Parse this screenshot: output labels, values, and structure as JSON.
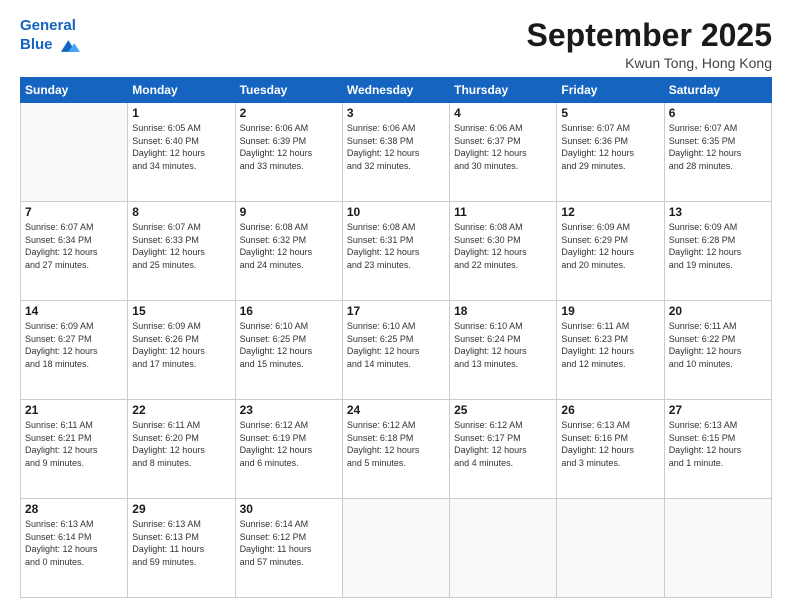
{
  "header": {
    "logo_line1": "General",
    "logo_line2": "Blue",
    "title": "September 2025",
    "subtitle": "Kwun Tong, Hong Kong"
  },
  "days_of_week": [
    "Sunday",
    "Monday",
    "Tuesday",
    "Wednesday",
    "Thursday",
    "Friday",
    "Saturday"
  ],
  "weeks": [
    [
      {
        "day": "",
        "info": ""
      },
      {
        "day": "1",
        "info": "Sunrise: 6:05 AM\nSunset: 6:40 PM\nDaylight: 12 hours\nand 34 minutes."
      },
      {
        "day": "2",
        "info": "Sunrise: 6:06 AM\nSunset: 6:39 PM\nDaylight: 12 hours\nand 33 minutes."
      },
      {
        "day": "3",
        "info": "Sunrise: 6:06 AM\nSunset: 6:38 PM\nDaylight: 12 hours\nand 32 minutes."
      },
      {
        "day": "4",
        "info": "Sunrise: 6:06 AM\nSunset: 6:37 PM\nDaylight: 12 hours\nand 30 minutes."
      },
      {
        "day": "5",
        "info": "Sunrise: 6:07 AM\nSunset: 6:36 PM\nDaylight: 12 hours\nand 29 minutes."
      },
      {
        "day": "6",
        "info": "Sunrise: 6:07 AM\nSunset: 6:35 PM\nDaylight: 12 hours\nand 28 minutes."
      }
    ],
    [
      {
        "day": "7",
        "info": "Sunrise: 6:07 AM\nSunset: 6:34 PM\nDaylight: 12 hours\nand 27 minutes."
      },
      {
        "day": "8",
        "info": "Sunrise: 6:07 AM\nSunset: 6:33 PM\nDaylight: 12 hours\nand 25 minutes."
      },
      {
        "day": "9",
        "info": "Sunrise: 6:08 AM\nSunset: 6:32 PM\nDaylight: 12 hours\nand 24 minutes."
      },
      {
        "day": "10",
        "info": "Sunrise: 6:08 AM\nSunset: 6:31 PM\nDaylight: 12 hours\nand 23 minutes."
      },
      {
        "day": "11",
        "info": "Sunrise: 6:08 AM\nSunset: 6:30 PM\nDaylight: 12 hours\nand 22 minutes."
      },
      {
        "day": "12",
        "info": "Sunrise: 6:09 AM\nSunset: 6:29 PM\nDaylight: 12 hours\nand 20 minutes."
      },
      {
        "day": "13",
        "info": "Sunrise: 6:09 AM\nSunset: 6:28 PM\nDaylight: 12 hours\nand 19 minutes."
      }
    ],
    [
      {
        "day": "14",
        "info": "Sunrise: 6:09 AM\nSunset: 6:27 PM\nDaylight: 12 hours\nand 18 minutes."
      },
      {
        "day": "15",
        "info": "Sunrise: 6:09 AM\nSunset: 6:26 PM\nDaylight: 12 hours\nand 17 minutes."
      },
      {
        "day": "16",
        "info": "Sunrise: 6:10 AM\nSunset: 6:25 PM\nDaylight: 12 hours\nand 15 minutes."
      },
      {
        "day": "17",
        "info": "Sunrise: 6:10 AM\nSunset: 6:25 PM\nDaylight: 12 hours\nand 14 minutes."
      },
      {
        "day": "18",
        "info": "Sunrise: 6:10 AM\nSunset: 6:24 PM\nDaylight: 12 hours\nand 13 minutes."
      },
      {
        "day": "19",
        "info": "Sunrise: 6:11 AM\nSunset: 6:23 PM\nDaylight: 12 hours\nand 12 minutes."
      },
      {
        "day": "20",
        "info": "Sunrise: 6:11 AM\nSunset: 6:22 PM\nDaylight: 12 hours\nand 10 minutes."
      }
    ],
    [
      {
        "day": "21",
        "info": "Sunrise: 6:11 AM\nSunset: 6:21 PM\nDaylight: 12 hours\nand 9 minutes."
      },
      {
        "day": "22",
        "info": "Sunrise: 6:11 AM\nSunset: 6:20 PM\nDaylight: 12 hours\nand 8 minutes."
      },
      {
        "day": "23",
        "info": "Sunrise: 6:12 AM\nSunset: 6:19 PM\nDaylight: 12 hours\nand 6 minutes."
      },
      {
        "day": "24",
        "info": "Sunrise: 6:12 AM\nSunset: 6:18 PM\nDaylight: 12 hours\nand 5 minutes."
      },
      {
        "day": "25",
        "info": "Sunrise: 6:12 AM\nSunset: 6:17 PM\nDaylight: 12 hours\nand 4 minutes."
      },
      {
        "day": "26",
        "info": "Sunrise: 6:13 AM\nSunset: 6:16 PM\nDaylight: 12 hours\nand 3 minutes."
      },
      {
        "day": "27",
        "info": "Sunrise: 6:13 AM\nSunset: 6:15 PM\nDaylight: 12 hours\nand 1 minute."
      }
    ],
    [
      {
        "day": "28",
        "info": "Sunrise: 6:13 AM\nSunset: 6:14 PM\nDaylight: 12 hours\nand 0 minutes."
      },
      {
        "day": "29",
        "info": "Sunrise: 6:13 AM\nSunset: 6:13 PM\nDaylight: 11 hours\nand 59 minutes."
      },
      {
        "day": "30",
        "info": "Sunrise: 6:14 AM\nSunset: 6:12 PM\nDaylight: 11 hours\nand 57 minutes."
      },
      {
        "day": "",
        "info": ""
      },
      {
        "day": "",
        "info": ""
      },
      {
        "day": "",
        "info": ""
      },
      {
        "day": "",
        "info": ""
      }
    ]
  ]
}
